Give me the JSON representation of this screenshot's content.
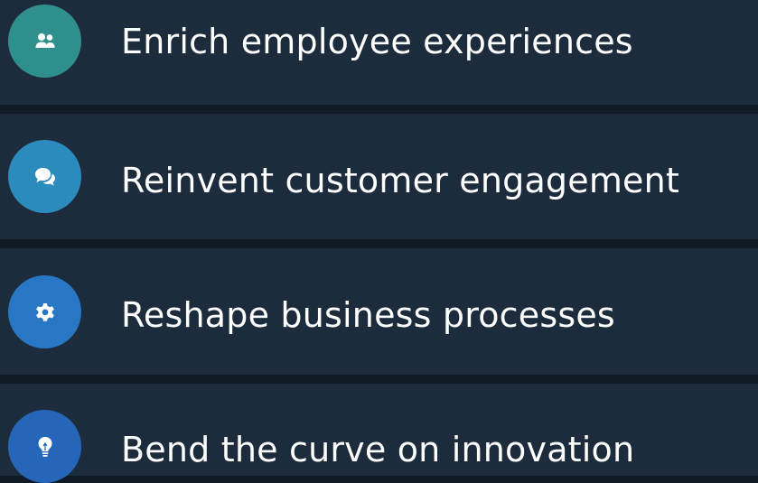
{
  "items": [
    {
      "label": "Enrich employee experiences",
      "icon": "people-icon",
      "color": "#2f8f8c"
    },
    {
      "label": "Reinvent customer engagement",
      "icon": "chat-bubbles-icon",
      "color": "#2c8bbd"
    },
    {
      "label": "Reshape business processes",
      "icon": "gear-icon",
      "color": "#2877c4"
    },
    {
      "label": "Bend the curve on innovation",
      "icon": "lightbulb-icon",
      "color": "#2666b8"
    }
  ]
}
